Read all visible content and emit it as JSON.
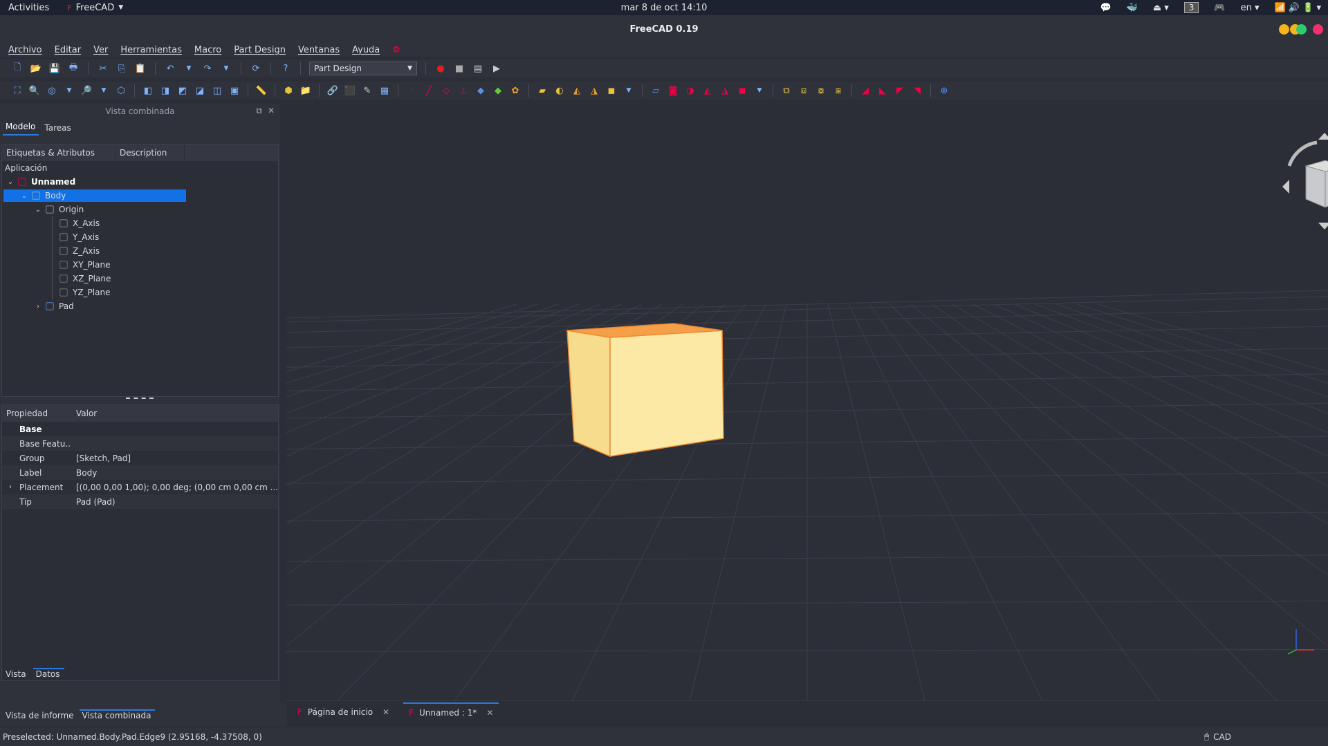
{
  "topbar": {
    "activities": "Activities",
    "app": "FreeCAD",
    "clock": "mar  8 de oct  14:10",
    "workspace": "3",
    "lang": "en"
  },
  "window": {
    "title": "FreeCAD 0.19",
    "controls": {
      "minimize": "#f5b51b",
      "maximize": "#2ecc71",
      "close": "#f0306c"
    }
  },
  "menu": [
    "Archivo",
    "Editar",
    "Ver",
    "Herramientas",
    "Macro",
    "Part Design",
    "Ventanas",
    "Ayuda"
  ],
  "toolbar": {
    "workbench": "Part Design"
  },
  "combo": {
    "title": "Vista combinada",
    "tabs": [
      "Modelo",
      "Tareas"
    ],
    "tree_headers": [
      "Etiquetas & Atributos",
      "Description"
    ],
    "app_label": "Aplicación",
    "tree": [
      {
        "label": "Unnamed",
        "depth": 0,
        "expanded": true,
        "icon": "document-icon"
      },
      {
        "label": "Body",
        "depth": 1,
        "expanded": true,
        "selected": true,
        "icon": "body-icon"
      },
      {
        "label": "Origin",
        "depth": 2,
        "expanded": true,
        "icon": "origin-icon"
      },
      {
        "label": "X_Axis",
        "depth": 3,
        "icon": "axis-icon"
      },
      {
        "label": "Y_Axis",
        "depth": 3,
        "icon": "axis-icon"
      },
      {
        "label": "Z_Axis",
        "depth": 3,
        "icon": "axis-icon"
      },
      {
        "label": "XY_Plane",
        "depth": 3,
        "icon": "plane-icon"
      },
      {
        "label": "XZ_Plane",
        "depth": 3,
        "icon": "plane-icon"
      },
      {
        "label": "YZ_Plane",
        "depth": 3,
        "icon": "plane-icon"
      },
      {
        "label": "Pad",
        "depth": 2,
        "expanded": false,
        "icon": "pad-icon"
      }
    ],
    "prop_headers": [
      "Propiedad",
      "Valor"
    ],
    "props": [
      {
        "key": "Base",
        "value": "",
        "group": true
      },
      {
        "key": "Base Featu...",
        "value": ""
      },
      {
        "key": "Group",
        "value": "[Sketch, Pad]"
      },
      {
        "key": "Label",
        "value": "Body"
      },
      {
        "key": "Placement",
        "value": "[(0,00 0,00 1,00); 0,00 deg; (0,00 cm  0,00 cm  ...",
        "expandable": true
      },
      {
        "key": "Tip",
        "value": "Pad (Pad)"
      }
    ],
    "view_tabs": [
      "Vista",
      "Datos"
    ],
    "panel_tabs": [
      "Vista de informe",
      "Vista combinada"
    ]
  },
  "documents": [
    {
      "label": "Página de inicio",
      "active": false
    },
    {
      "label": "Unnamed : 1*",
      "active": true
    }
  ],
  "status": {
    "text": "Preselected: Unnamed.Body.Pad.Edge9 (2.95168, -4.37508, 0)",
    "nav_style": "CAD"
  }
}
